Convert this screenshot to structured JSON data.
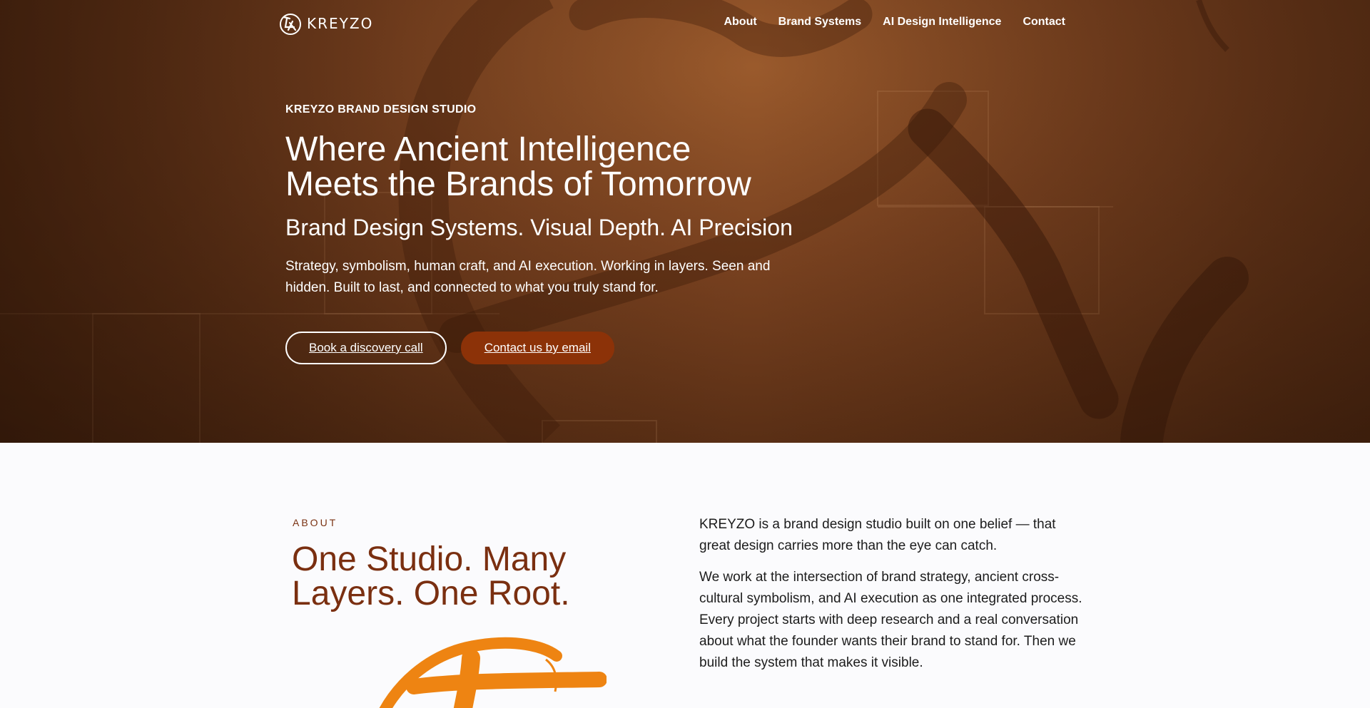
{
  "brand": {
    "name": "KREYZO",
    "logo_icon": "kreyzo-glyph-icon"
  },
  "nav": {
    "links": [
      "About",
      "Brand Systems",
      "AI Design Intelligence",
      "Contact"
    ]
  },
  "hero": {
    "eyebrow": "KREYZO BRAND DESIGN STUDIO",
    "title_line1": "Where Ancient Intelligence",
    "title_line2": "Meets the Brands of Tomorrow",
    "subtitle": "Brand Design Systems. Visual Depth. AI Precision",
    "description": "Strategy, symbolism, human craft, and AI execution. Working in layers. Seen and hidden. Built to last, and connected to what you truly stand for.",
    "primary_button": "Book a discovery call",
    "secondary_button": "Contact us by email"
  },
  "about": {
    "eyebrow": "ABOUT",
    "title_line1": "One Studio. Many",
    "title_line2": "Layers. One Root.",
    "paragraph1": "KREYZO is a brand design studio built on one belief — that great design carries more than the eye can catch.",
    "paragraph2": "We work at the intersection of brand strategy, ancient cross-cultural symbolism, and AI execution as one integrated process. Every project starts with deep research and a real conversation about what the founder wants their brand to stand for. Then we build the system that makes it visible."
  },
  "colors": {
    "hero_bg": "#7a4220",
    "accent_dark": "#8c3208",
    "about_title": "#7a2f10",
    "brush_orange": "#ee8412"
  }
}
